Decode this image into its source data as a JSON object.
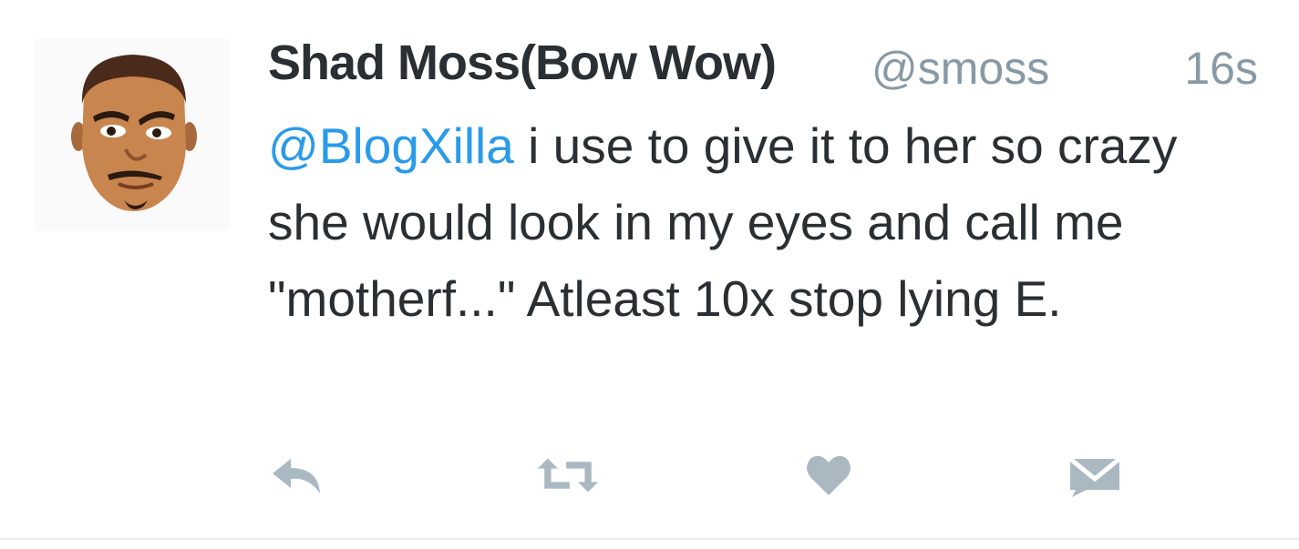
{
  "tweet": {
    "display_name": "Shad Moss(Bow Wow)",
    "handle": "@smoss",
    "timestamp": "16s",
    "mention": "@BlogXilla",
    "body": " i use to give it to her so crazy she would look in my eyes and call me \"motherf...\" Atleast 10x stop lying E."
  },
  "actions": {
    "reply_icon": "reply-icon",
    "retweet_icon": "retweet-icon",
    "like_icon": "heart-icon",
    "dm_icon": "envelope-icon"
  },
  "colors": {
    "name": "#292f33",
    "secondary": "#8899a6",
    "link": "#2a9be8",
    "icon": "#aab8c2",
    "divider": "#e6ecf0"
  }
}
